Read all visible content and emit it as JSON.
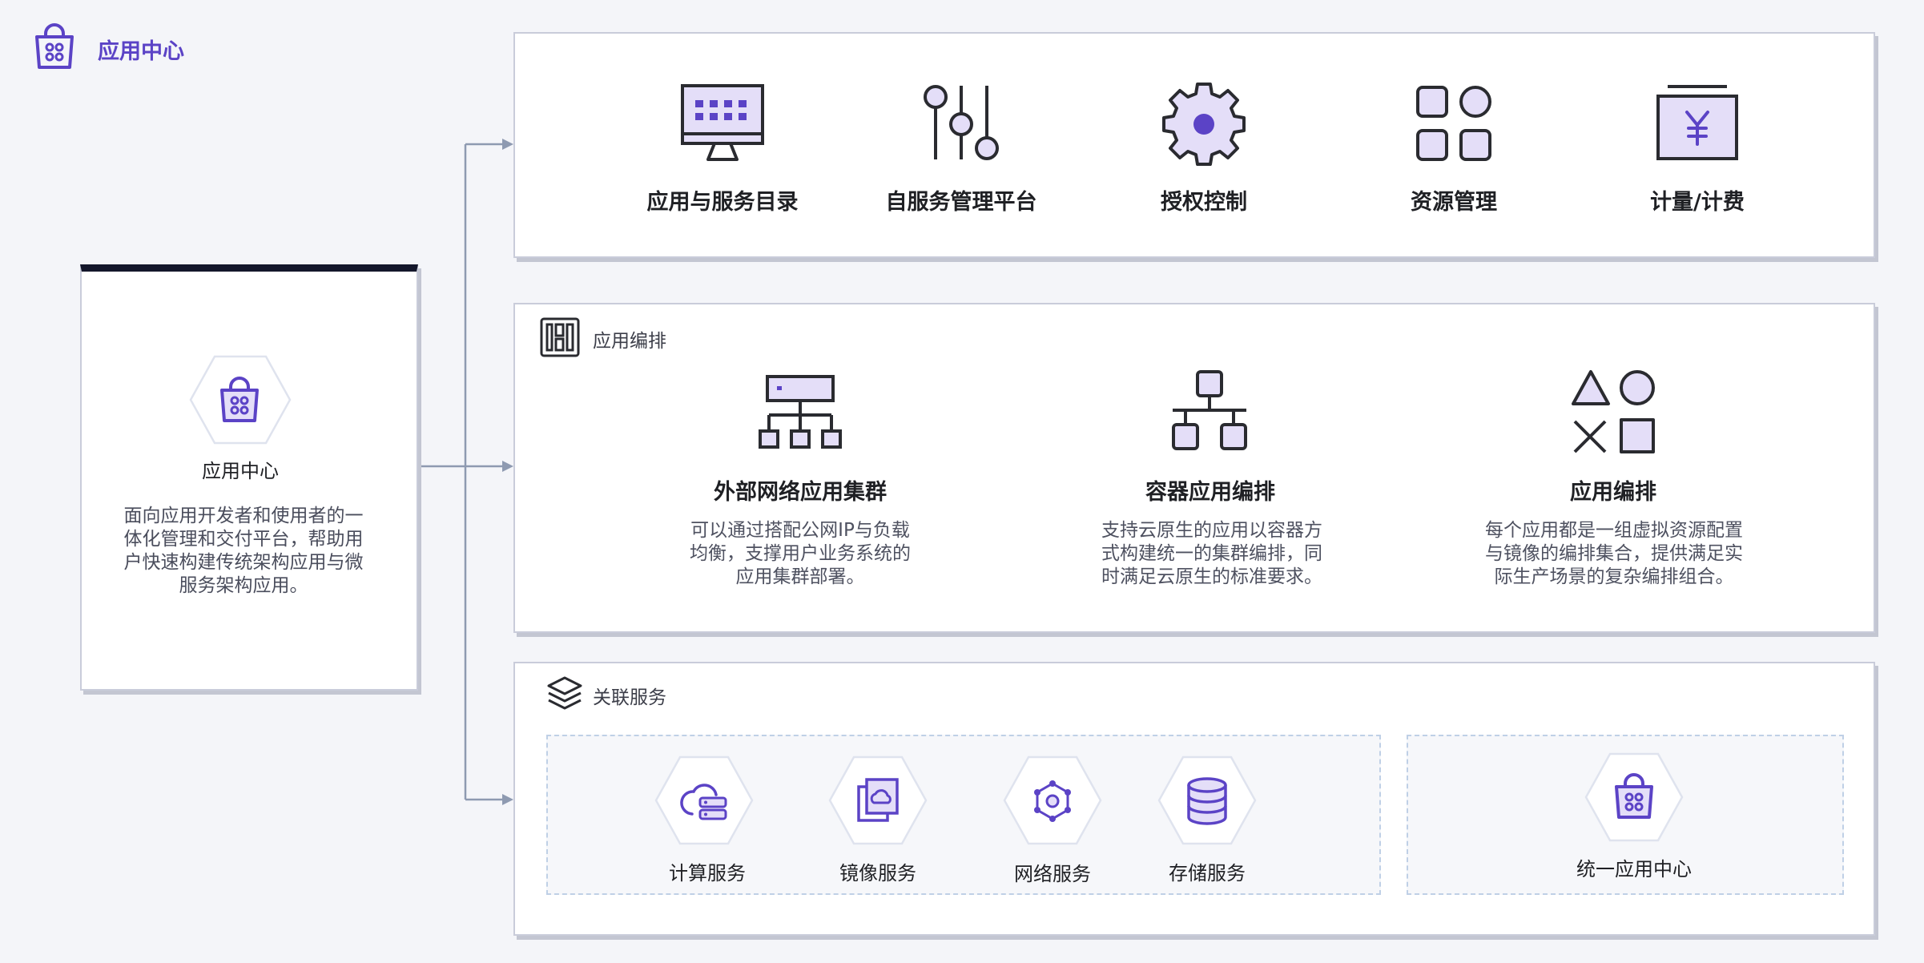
{
  "header": {
    "title": "应用中心",
    "icon": "shopping-bag-icon"
  },
  "intro_card": {
    "title": "应用中心",
    "description": "面向应用开发者和使用者的一体化管理和交付平台，帮助用户快速构建传统架构应用与微服务架构应用。",
    "icon": "shopping-bag-icon"
  },
  "top_features": [
    {
      "label": "应用与服务目录",
      "icon": "monitor-icon"
    },
    {
      "label": "自服务管理平台",
      "icon": "sliders-icon"
    },
    {
      "label": "授权控制",
      "icon": "gear-icon"
    },
    {
      "label": "资源管理",
      "icon": "grid-icon"
    },
    {
      "label": "计量/计费",
      "icon": "yen-box-icon"
    }
  ],
  "orchestration": {
    "title": "应用编排",
    "items": [
      {
        "title": "外部网络应用集群",
        "description": "可以通过搭配公网IP与负载均衡，支撑用户业务系统的应用集群部署。",
        "icon": "network-tree-icon"
      },
      {
        "title": "容器应用编排",
        "description": "支持云原生的应用以容器方式构建统一的集群编排，同时满足云原生的标准要求。",
        "icon": "hierarchy-icon"
      },
      {
        "title": "应用编排",
        "description": "每个应用都是一组虚拟资源配置与镜像的编排集合，提供满足实际生产场景的复杂编排组合。",
        "icon": "shapes-icon"
      }
    ]
  },
  "related": {
    "title": "关联服务",
    "services": [
      {
        "label": "计算服务",
        "icon": "compute-icon"
      },
      {
        "label": "镜像服务",
        "icon": "image-icon"
      },
      {
        "label": "网络服务",
        "icon": "network-icon"
      },
      {
        "label": "存储服务",
        "icon": "database-icon"
      }
    ],
    "unified": {
      "label": "统一应用中心",
      "icon": "shopping-bag-icon"
    }
  },
  "colors": {
    "accent": "#5b43c6",
    "icon_fill": "#e4def8",
    "stroke": "#2a2b30",
    "connector": "#8e9ab1"
  }
}
